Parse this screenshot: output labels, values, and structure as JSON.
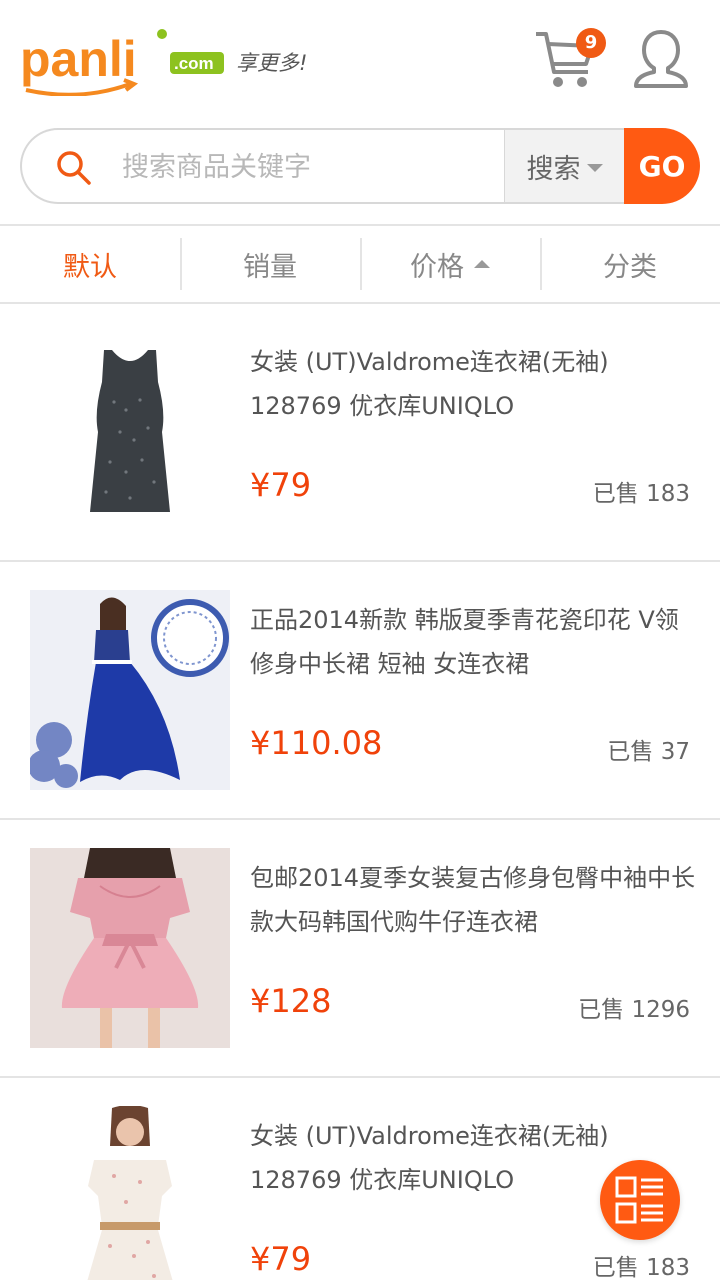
{
  "header": {
    "logo_text": "panli",
    "logo_domain": ".com",
    "slogan": "享更多!",
    "cart_count": "9"
  },
  "search": {
    "placeholder": "搜索商品关键字",
    "type_label": "搜索",
    "go_label": "GO"
  },
  "sort": {
    "items": [
      {
        "label": "默认"
      },
      {
        "label": "销量"
      },
      {
        "label": "价格"
      },
      {
        "label": "分类"
      }
    ]
  },
  "products": [
    {
      "title": "女装 (UT)Valdrome连衣裙(无袖) 128769 优衣库UNIQLO",
      "price": "¥79",
      "sold": "已售 183"
    },
    {
      "title": "正品2014新款  韩版夏季青花瓷印花 V领修身中长裙 短袖 女连衣裙",
      "price": "¥110.08",
      "sold": "已售 37"
    },
    {
      "title": "包邮2014夏季女装复古修身包臀中袖中长款大码韩国代购牛仔连衣裙",
      "price": "¥128",
      "sold": "已售 1296"
    },
    {
      "title": "女装 (UT)Valdrome连衣裙(无袖) 128769 优衣库UNIQLO",
      "price": "¥79",
      "sold": "已售 183"
    }
  ],
  "colors": {
    "accent": "#ff5a12",
    "price": "#f0420a",
    "logo_orange": "#f5891f",
    "logo_green": "#8dc21f"
  },
  "icons": {
    "cart": "shopping-cart-icon",
    "user": "user-icon",
    "search": "search-icon",
    "fab": "list-view-icon"
  }
}
